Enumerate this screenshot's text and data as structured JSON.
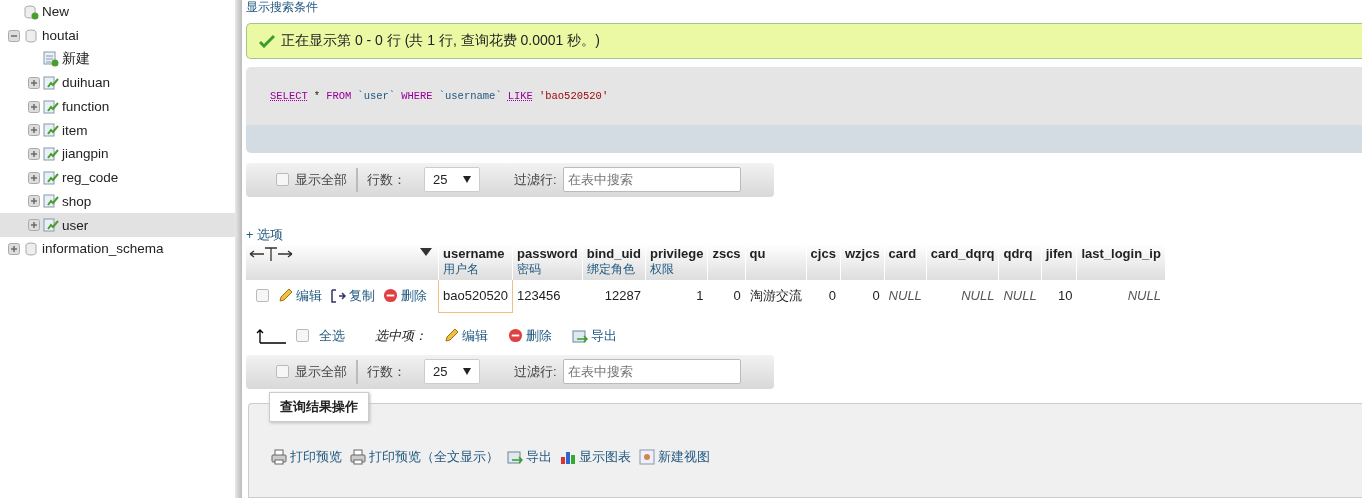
{
  "sidebar": {
    "tree": [
      {
        "label": "New",
        "kind": "new",
        "selected": false
      },
      {
        "label": "houtai",
        "kind": "database",
        "expanded": true,
        "selected": false,
        "children": [
          {
            "label": "新建",
            "kind": "new-table",
            "selected": false
          },
          {
            "label": "duihuan",
            "kind": "table",
            "selected": false
          },
          {
            "label": "function",
            "kind": "table",
            "selected": false
          },
          {
            "label": "item",
            "kind": "table",
            "selected": false
          },
          {
            "label": "jiangpin",
            "kind": "table",
            "selected": false
          },
          {
            "label": "reg_code",
            "kind": "table",
            "selected": false
          },
          {
            "label": "shop",
            "kind": "table",
            "selected": false
          },
          {
            "label": "user",
            "kind": "table",
            "selected": true
          }
        ]
      },
      {
        "label": "information_schema",
        "kind": "database",
        "expanded": false,
        "selected": false
      }
    ]
  },
  "search_toggle": "显示搜索条件",
  "message": "正在显示第 0 - 0 行 (共 1 行, 查询花费 0.0001 秒。)",
  "sql": [
    {
      "text": "SELECT",
      "kind": "keyword-link"
    },
    {
      "text": "*",
      "kind": "plain"
    },
    {
      "text": "FROM",
      "kind": "keyword"
    },
    {
      "text": "`user`",
      "kind": "identifier"
    },
    {
      "text": "WHERE",
      "kind": "keyword"
    },
    {
      "text": "`username`",
      "kind": "identifier"
    },
    {
      "text": "LIKE",
      "kind": "keyword-link"
    },
    {
      "text": "'bao520520'",
      "kind": "string"
    }
  ],
  "nav_top": {
    "show_all": "显示全部",
    "show_all_checked": false,
    "rows_label": "行数：",
    "rows_value": "25",
    "filter_label": "过滤行:",
    "filter_placeholder": "在表中搜索"
  },
  "options_link": "+ 选项",
  "table": {
    "columns": [
      {
        "name": "username",
        "comment": "用户名"
      },
      {
        "name": "password",
        "comment": "密码"
      },
      {
        "name": "bind_uid",
        "comment": "绑定角色"
      },
      {
        "name": "privilege",
        "comment": "权限"
      },
      {
        "name": "zscs"
      },
      {
        "name": "qu"
      },
      {
        "name": "cjcs"
      },
      {
        "name": "wzjcs"
      },
      {
        "name": "card"
      },
      {
        "name": "card_dqrq"
      },
      {
        "name": "qdrq"
      },
      {
        "name": "jifen"
      },
      {
        "name": "last_login_ip"
      }
    ],
    "rows": [
      {
        "checked": false,
        "actions": [
          {
            "label": "编辑",
            "kind": "edit"
          },
          {
            "label": "复制",
            "kind": "copy"
          },
          {
            "label": "删除",
            "kind": "delete"
          }
        ],
        "cells": [
          {
            "text": "bao520520",
            "kind": "text"
          },
          {
            "text": "123456",
            "kind": "text"
          },
          {
            "text": "12287",
            "kind": "number"
          },
          {
            "text": "1",
            "kind": "number"
          },
          {
            "text": "0",
            "kind": "number"
          },
          {
            "text": "淘游交流",
            "kind": "text"
          },
          {
            "text": "0",
            "kind": "number"
          },
          {
            "text": "0",
            "kind": "number"
          },
          {
            "text": "NULL",
            "kind": "null"
          },
          {
            "text": "NULL",
            "kind": "null"
          },
          {
            "text": "NULL",
            "kind": "null"
          },
          {
            "text": "10",
            "kind": "number"
          },
          {
            "text": "NULL",
            "kind": "null"
          }
        ]
      }
    ]
  },
  "bulk": {
    "select_all": "全选",
    "checked": false,
    "with_selected": "选中项：",
    "actions": [
      {
        "label": "编辑",
        "kind": "edit"
      },
      {
        "label": "删除",
        "kind": "delete"
      },
      {
        "label": "导出",
        "kind": "export"
      }
    ]
  },
  "nav_bottom": {
    "show_all": "显示全部",
    "show_all_checked": false,
    "rows_label": "行数：",
    "rows_value": "25",
    "filter_label": "过滤行:",
    "filter_placeholder": "在表中搜索"
  },
  "operations": {
    "legend": "查询结果操作",
    "actions": [
      {
        "label": "打印预览",
        "kind": "print"
      },
      {
        "label": "打印预览（全文显示）",
        "kind": "print"
      },
      {
        "label": "导出",
        "kind": "export"
      },
      {
        "label": "显示图表",
        "kind": "chart"
      },
      {
        "label": "新建视图",
        "kind": "view"
      }
    ]
  }
}
